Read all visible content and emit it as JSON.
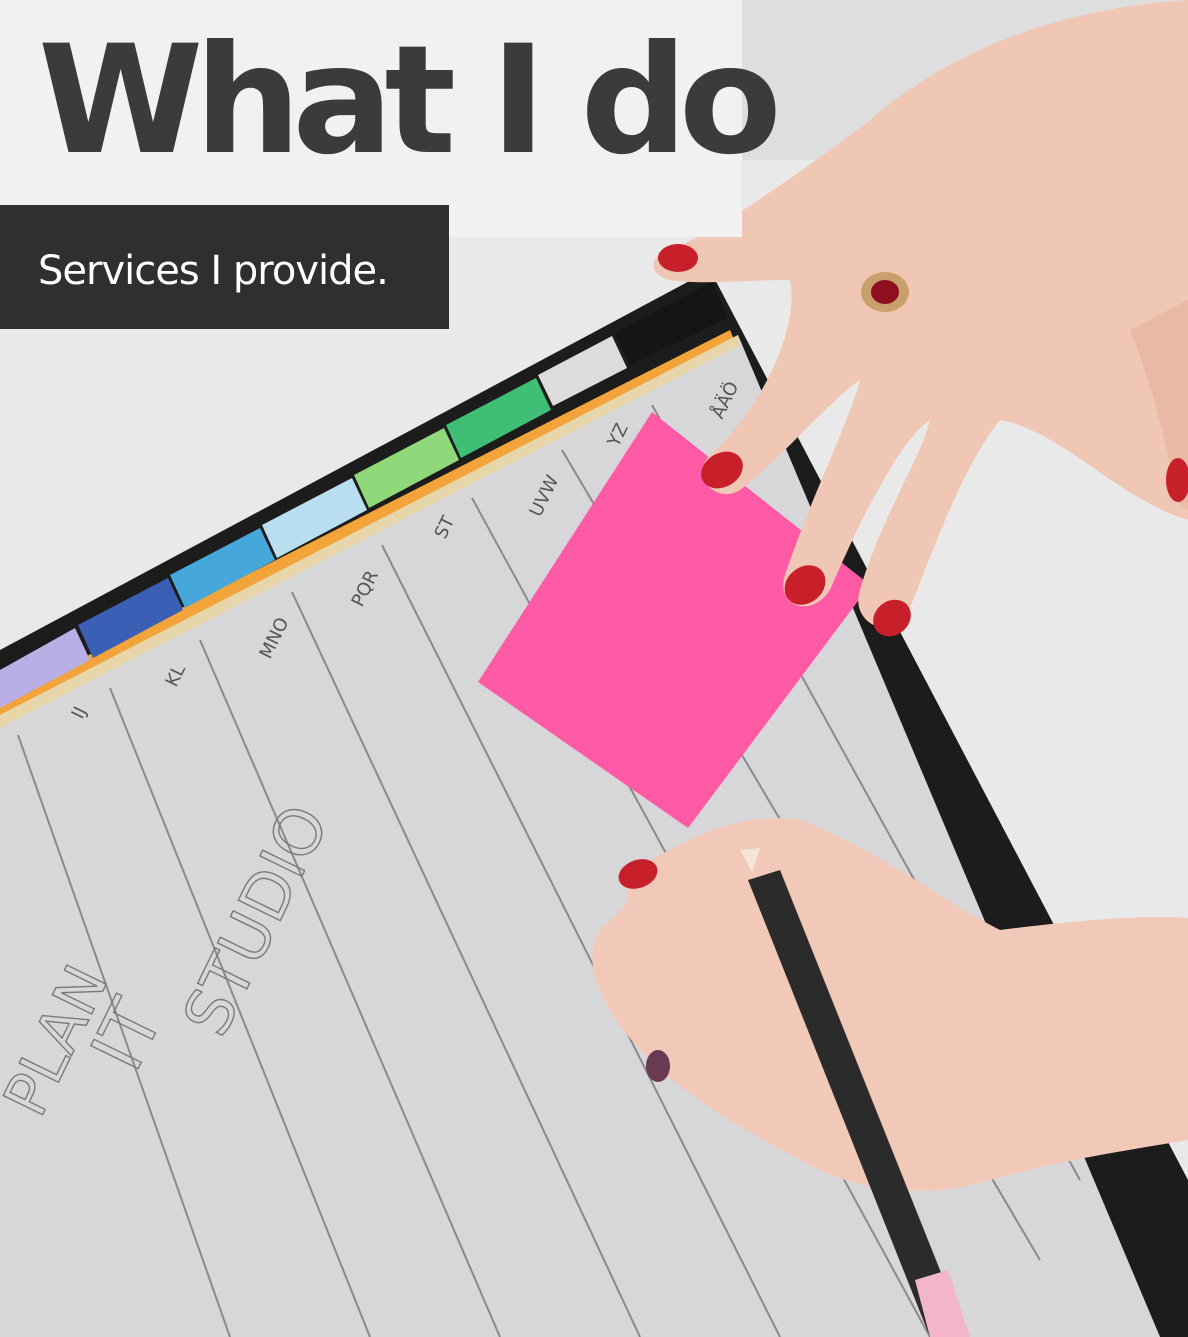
{
  "header": {
    "title": "What I do",
    "subtitle": "Services I provide."
  },
  "photo": {
    "tab_labels": [
      "IJ",
      "KL",
      "MNO",
      "PQR",
      "ST",
      "UVW",
      "YZ",
      "ÅÄÖ"
    ],
    "handwriting": [
      "PLAN",
      "IT",
      "STUDIO"
    ]
  },
  "colors": {
    "title_box": "#f1f1f1",
    "title_text": "#3b3b3b",
    "subtitle_box": "#2f2f2f",
    "subtitle_text": "#ffffff",
    "sticky_note": "#ff5aa5",
    "nail_polish": "#c8202a"
  }
}
